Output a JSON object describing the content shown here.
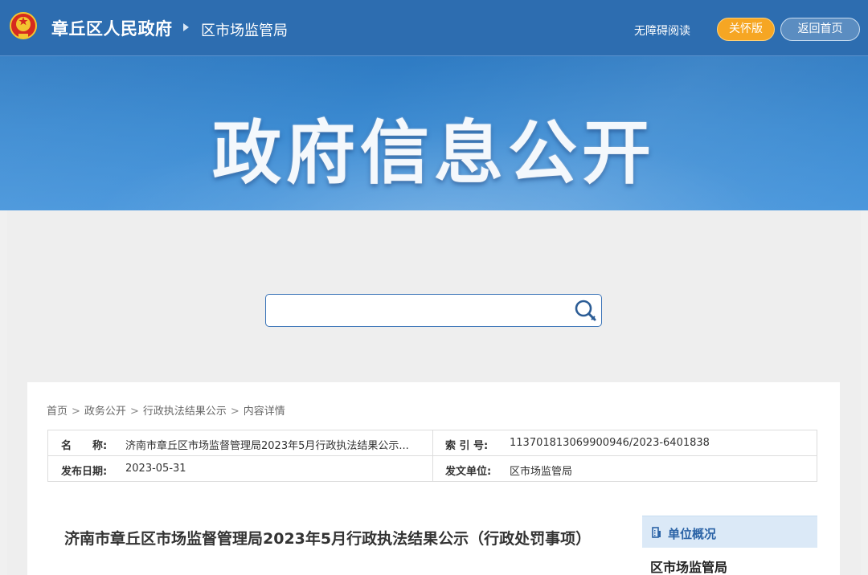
{
  "header": {
    "site_name": "章丘区人民政府",
    "dept_name": "区市场监管局",
    "accessible_label": "无障碍阅读",
    "elder_label": "关怀版",
    "home_label": "返回首页"
  },
  "hero": {
    "title": "政府信息公开"
  },
  "search": {
    "placeholder": ""
  },
  "breadcrumb": {
    "items": [
      "首页",
      "政务公开",
      "行政执法结果公示",
      "内容详情"
    ],
    "separator": ">"
  },
  "meta": {
    "name_label": "名　　称:",
    "name_value": "济南市章丘区市场监督管理局2023年5月行政执法结果公示...",
    "index_label": "索 引 号:",
    "index_value": "113701813069900946/2023-6401838",
    "date_label": "发布日期:",
    "date_value": "2023-05-31",
    "unit_label": "发文单位:",
    "unit_value": "区市场监管局"
  },
  "article": {
    "title": "济南市章丘区市场监督管理局2023年5月行政执法结果公示（行政处罚事项）"
  },
  "side": {
    "head_label": "单位概况",
    "item": "区市场监管局"
  },
  "colors": {
    "banner": "#2d6db0",
    "accent_orange": "#f6a623",
    "link_blue": "#2b63a6"
  }
}
